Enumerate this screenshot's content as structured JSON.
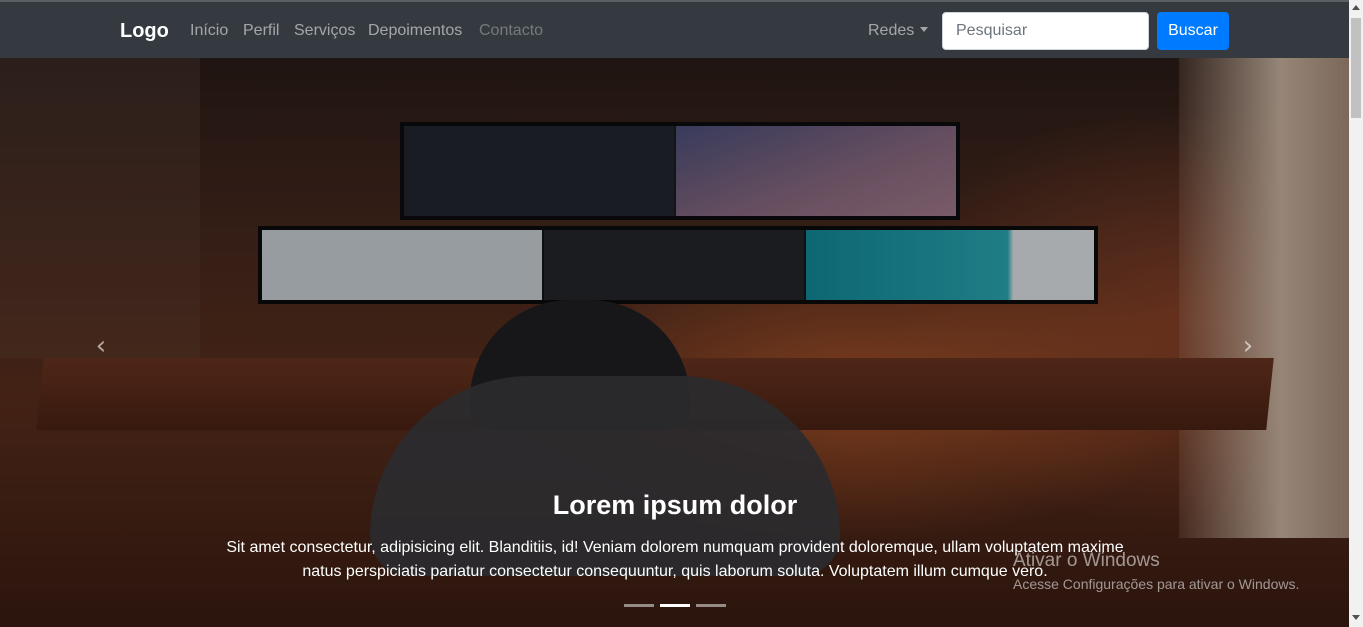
{
  "navbar": {
    "brand": "Logo",
    "links": [
      "Início",
      "Perfil",
      "Serviços",
      "Depoimentos",
      "Contacto"
    ],
    "dropdown_label": "Redes",
    "search_placeholder": "Pesquisar",
    "search_button": "Buscar"
  },
  "carousel": {
    "caption_title": "Lorem ipsum dolor",
    "caption_text": "Sit amet consectetur, adipisicing elit. Blanditiis, id! Veniam dolorem numquam provident doloremque, ullam voluptatem maxime natus perspiciatis pariatur consectetur consequuntur, quis laborum soluta. Voluptatem illum cumque vero.",
    "prev_icon": "chevron-left-icon",
    "next_icon": "chevron-right-icon",
    "active_slide": 2,
    "slide_count": 3
  },
  "watermark": {
    "title": "Ativar o Windows",
    "subtitle": "Acesse Configurações para ativar o Windows."
  },
  "colors": {
    "navbar_bg": "#343a40",
    "button_primary": "#007bff"
  }
}
